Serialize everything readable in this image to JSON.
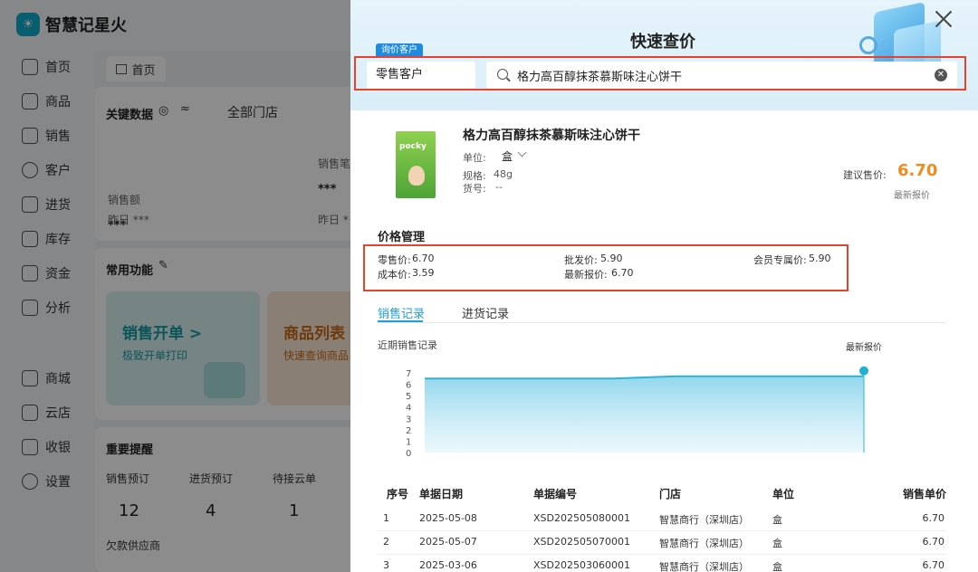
{
  "app": {
    "logo_icon": "sun-leaf-icon",
    "logo_text": "智慧记星火",
    "nav": [
      {
        "label": "首页",
        "icon": "home-icon"
      },
      {
        "label": "商品",
        "icon": "box-icon"
      },
      {
        "label": "销售",
        "icon": "clipboard-icon"
      },
      {
        "label": "客户",
        "icon": "user-icon"
      },
      {
        "label": "进货",
        "icon": "truck-icon"
      },
      {
        "label": "库存",
        "icon": "warehouse-icon"
      },
      {
        "label": "资金",
        "icon": "wallet-icon"
      },
      {
        "label": "分析",
        "icon": "chart-icon"
      },
      {
        "label": "商城",
        "icon": "shop-icon"
      },
      {
        "label": "云店",
        "icon": "cloud-shop-icon"
      },
      {
        "label": "收银",
        "icon": "cashier-icon"
      },
      {
        "label": "设置",
        "icon": "gear-icon"
      }
    ],
    "home_tab": "首页",
    "key_data": {
      "title": "关键数据",
      "store_filter": "全部门店",
      "sales_amount_label": "销售额",
      "sales_amount_value": "***",
      "sales_amount_prev": "昨日 ***",
      "sales_count_label": "销售笔",
      "sales_count_value": "***",
      "sales_count_prev": "昨日 *"
    },
    "common": {
      "title": "常用功能",
      "tile1_title": "销售开单 >",
      "tile1_sub": "极致开单打印",
      "tile2_title": "商品列表",
      "tile2_sub": "快速查询商品"
    },
    "reminders": {
      "title": "重要提醒",
      "items": [
        {
          "label": "销售预订",
          "count": "12"
        },
        {
          "label": "进货预订",
          "count": "4"
        },
        {
          "label": "待接云单",
          "count": "1"
        }
      ],
      "extra": "欠款供应商"
    }
  },
  "drawer": {
    "title": "快速查价",
    "customer_tag": "询价客户",
    "customer_value": "零售客户",
    "search_value": "格力高百醇抹茶慕斯味注心饼干",
    "product": {
      "name": "格力高百醇抹茶慕斯味注心饼干",
      "image_brand": "pocky",
      "unit_label": "单位:",
      "unit_value": "盒",
      "spec_label": "规格:",
      "spec_value": "48g",
      "code_label": "货号:",
      "code_value": "--",
      "suggest_label": "建议售价:",
      "suggest_value": "6.70",
      "suggest_note": "最新报价"
    },
    "price_mgmt": {
      "title": "价格管理",
      "items": [
        {
          "label": "零售价:",
          "value": "6.70"
        },
        {
          "label": "批发价:",
          "value": "5.90"
        },
        {
          "label": "会员专属价:",
          "value": "5.90"
        },
        {
          "label": "成本价:",
          "value": "3.59"
        },
        {
          "label": "最新报价:",
          "value": "6.70"
        }
      ]
    },
    "tabs": [
      "销售记录",
      "进货记录"
    ],
    "chart_label": "近期销售记录",
    "chart_marker_label": "最新报价",
    "table": {
      "headers": [
        "序号",
        "单据日期",
        "单据编号",
        "门店",
        "单位",
        "销售单价"
      ],
      "rows": [
        [
          "1",
          "2025-05-08",
          "XSD202505080001",
          "智慧商行（深圳店）",
          "盒",
          "6.70"
        ],
        [
          "2",
          "2025-05-07",
          "XSD202505070001",
          "智慧商行（深圳店）",
          "盒",
          "6.70"
        ],
        [
          "3",
          "2025-03-06",
          "XSD202503060001",
          "智慧商行（深圳店）",
          "盒",
          "6.70"
        ]
      ]
    }
  },
  "colors": {
    "accent": "#1e9fd8",
    "price": "#f28a1e",
    "highlight": "#e8412c"
  },
  "chart_data": {
    "type": "area",
    "title": "近期销售记录",
    "x": [
      1,
      2,
      3,
      4,
      5,
      6,
      7,
      8
    ],
    "values": [
      6.5,
      6.5,
      6.5,
      6.5,
      6.7,
      6.7,
      6.7,
      6.7
    ],
    "ylim": [
      0,
      7
    ],
    "yticks": [
      0,
      1,
      2,
      3,
      4,
      5,
      6,
      7
    ],
    "grid": false,
    "annotation": "最新报价"
  }
}
